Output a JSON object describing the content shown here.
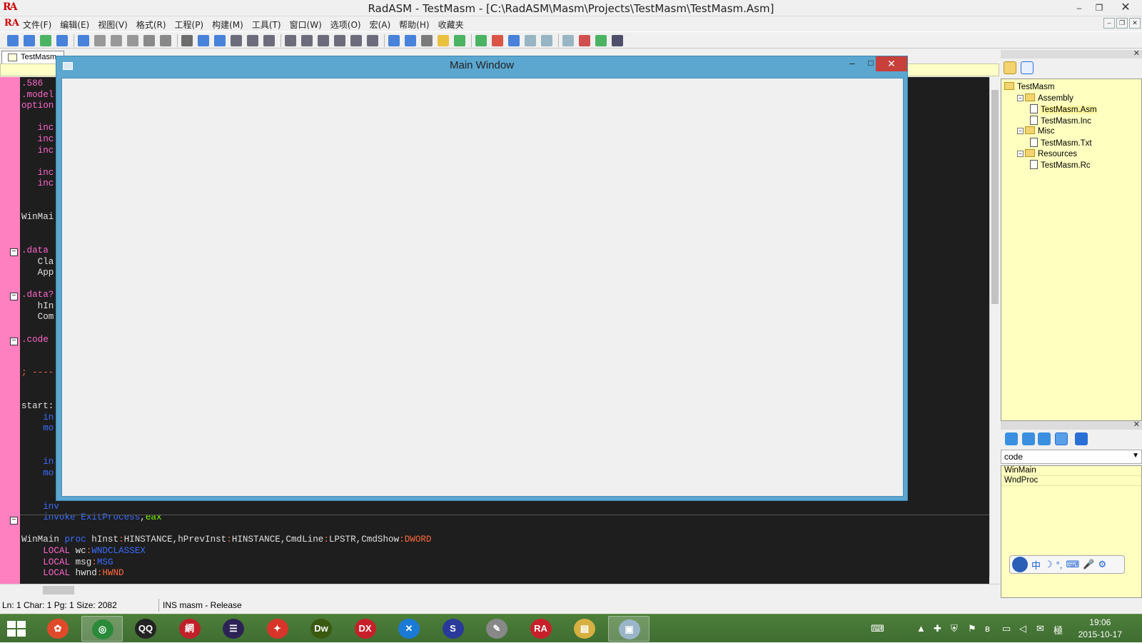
{
  "window": {
    "title": "RadASM - TestMasm - [C:\\RadASM\\Masm\\Projects\\TestMasm\\TestMasm.Asm]",
    "logo": "RA",
    "minimize_label": "–",
    "restore_label": "❐",
    "close_label": "✕"
  },
  "menu": {
    "items": [
      "文件(F)",
      "编辑(E)",
      "视图(V)",
      "格式(R)",
      "工程(P)",
      "构建(M)",
      "工具(T)",
      "窗口(W)",
      "选项(O)",
      "宏(A)",
      "帮助(H)",
      "收藏夹"
    ],
    "mdi_buttons": [
      "–",
      "❐",
      "✕"
    ]
  },
  "toolbar": {
    "icons": [
      "print-icon",
      "new-file-icon",
      "open-file-icon",
      "save-icon",
      "save-all-icon",
      "cut-icon",
      "copy-icon",
      "paste-icon",
      "undo-icon",
      "redo-icon",
      "delete-icon",
      "find-icon",
      "replace-icon",
      "bookmark-toggle-icon",
      "bookmark-next-icon",
      "bookmark-prev-icon",
      "bookmark-clear-icon",
      "indent-icon",
      "outdent-icon",
      "comment-icon",
      "uncomment-icon",
      "convert-case-icon",
      "dialog-edit-icon",
      "grid-icon",
      "build-tools-icon",
      "snap-icon",
      "compile-icon",
      "assemble-icon",
      "link-icon",
      "run-icon",
      "export-icon",
      "project-icon",
      "properties-icon",
      "color-palette-icon",
      "palette-icon",
      "preview-icon"
    ],
    "colors": {
      "blue": "#2a6fd6",
      "green": "#2fa84a",
      "red": "#d63a2a",
      "yellow": "#e8b820"
    }
  },
  "editor": {
    "tab_label": "TestMasm",
    "gutter_color": "#ff80c0",
    "background": "#1e1e1e",
    "visible_code": [
      [
        {
          "t": ".586",
          "c": "dir"
        }
      ],
      [
        {
          "t": ".model",
          "c": "dir"
        }
      ],
      [
        {
          "t": "option",
          "c": "dir"
        }
      ],
      [],
      [
        {
          "t": "   inc",
          "c": "dir"
        }
      ],
      [
        {
          "t": "   inc",
          "c": "dir"
        }
      ],
      [
        {
          "t": "   inc",
          "c": "dir"
        }
      ],
      [],
      [
        {
          "t": "   inc",
          "c": "dir"
        }
      ],
      [
        {
          "t": "   inc",
          "c": "dir"
        }
      ],
      [],
      [],
      [
        {
          "t": "WinMai",
          "c": "typ"
        }
      ],
      [],
      [],
      [
        {
          "t": ".data",
          "c": "dir"
        }
      ],
      [
        {
          "t": "   Cla",
          "c": "typ"
        }
      ],
      [
        {
          "t": "   App",
          "c": "typ"
        }
      ],
      [],
      [
        {
          "t": ".data?",
          "c": "dir"
        }
      ],
      [
        {
          "t": "   hIn",
          "c": "typ"
        }
      ],
      [
        {
          "t": "   Com",
          "c": "typ"
        }
      ],
      [],
      [
        {
          "t": ".code",
          "c": "dir"
        }
      ],
      [],
      [],
      [
        {
          "t": "; ----",
          "c": "red"
        }
      ],
      [],
      [],
      [
        {
          "t": "start:",
          "c": "typ"
        }
      ],
      [
        {
          "t": "    in",
          "c": "blu"
        }
      ],
      [
        {
          "t": "    mo",
          "c": "blu"
        }
      ],
      [],
      [],
      [
        {
          "t": "    in",
          "c": "blu"
        }
      ],
      [
        {
          "t": "    mo",
          "c": "blu"
        }
      ],
      [],
      [],
      [
        {
          "t": "    inv",
          "c": "blu"
        }
      ],
      [
        {
          "t": "    invoke ",
          "c": "blu"
        },
        {
          "t": "ExitProcess",
          "c": "blu"
        },
        {
          "t": ",",
          "c": "typ"
        },
        {
          "t": "eax",
          "c": "grn"
        }
      ],
      [],
      [
        {
          "t": "WinMain ",
          "c": "typ"
        },
        {
          "t": "proc",
          "c": "blu"
        },
        {
          "t": " hInst",
          "c": "typ"
        },
        {
          "t": ":",
          "c": "red"
        },
        {
          "t": "HINSTANCE",
          "c": "typ"
        },
        {
          "t": ",",
          "c": "typ"
        },
        {
          "t": "hPrevInst",
          "c": "typ"
        },
        {
          "t": ":",
          "c": "red"
        },
        {
          "t": "HINSTANCE",
          "c": "typ"
        },
        {
          "t": ",",
          "c": "typ"
        },
        {
          "t": "CmdLine",
          "c": "typ"
        },
        {
          "t": ":",
          "c": "red"
        },
        {
          "t": "LPSTR",
          "c": "typ"
        },
        {
          "t": ",",
          "c": "typ"
        },
        {
          "t": "CmdShow",
          "c": "typ"
        },
        {
          "t": ":",
          "c": "red"
        },
        {
          "t": "DWORD",
          "c": "red"
        }
      ],
      [
        {
          "t": "    LOCAL ",
          "c": "kw"
        },
        {
          "t": "wc",
          "c": "typ"
        },
        {
          "t": ":",
          "c": "red"
        },
        {
          "t": "WNDCLASSEX",
          "c": "blu"
        }
      ],
      [
        {
          "t": "    LOCAL ",
          "c": "kw"
        },
        {
          "t": "msg",
          "c": "typ"
        },
        {
          "t": ":",
          "c": "red"
        },
        {
          "t": "MSG",
          "c": "blu"
        }
      ],
      [
        {
          "t": "    LOCAL ",
          "c": "kw"
        },
        {
          "t": "hwnd",
          "c": "typ"
        },
        {
          "t": ":",
          "c": "red"
        },
        {
          "t": "HWND",
          "c": "red"
        }
      ]
    ]
  },
  "status": {
    "position": "Ln: 1 Char: 1 Pg: 1 Size: 2082",
    "mode": "INS masm - Release"
  },
  "project": {
    "tree": [
      {
        "label": "TestMasm",
        "kind": "folder",
        "level": 0
      },
      {
        "label": "Assembly",
        "kind": "folder",
        "level": 1
      },
      {
        "label": "TestMasm.Asm",
        "kind": "file",
        "level": 2,
        "selected": true
      },
      {
        "label": "TestMasm.Inc",
        "kind": "file",
        "level": 2
      },
      {
        "label": "Misc",
        "kind": "folder",
        "level": 1
      },
      {
        "label": "TestMasm.Txt",
        "kind": "file",
        "level": 2
      },
      {
        "label": "Resources",
        "kind": "folder",
        "level": 1
      },
      {
        "label": "TestMasm.Rc",
        "kind": "file",
        "level": 2
      }
    ],
    "panel_bg": "#ffffc0"
  },
  "properties": {
    "dropdown_value": "code",
    "procs": [
      "WinMain",
      "WndProc"
    ]
  },
  "ime": {
    "glyphs": [
      "中",
      "☽",
      "°,",
      "⌨",
      "🎤",
      "⚙"
    ]
  },
  "dialog": {
    "title": "Main Window",
    "frame_color": "#5ba7d0",
    "close_color": "#c7403a",
    "minimize_label": "–",
    "maximize_label": "□",
    "close_label": "✕"
  },
  "taskbar": {
    "apps": [
      {
        "name": "pinwheel-app-icon",
        "glyph": "✿",
        "color": "#e04a2a"
      },
      {
        "name": "chrome-icon",
        "glyph": "◎",
        "color": "#2a8a3a",
        "active": true
      },
      {
        "name": "qq-icon",
        "glyph": "QQ",
        "color": "#222"
      },
      {
        "name": "netease-icon",
        "glyph": "網",
        "color": "#c0202a"
      },
      {
        "name": "eclipse-icon",
        "glyph": "☰",
        "color": "#2c2255"
      },
      {
        "name": "xcode-bird-icon",
        "glyph": "✦",
        "color": "#d8352a"
      },
      {
        "name": "dreamweaver-icon",
        "glyph": "Dw",
        "color": "#3a5a10"
      },
      {
        "name": "dx-icon",
        "glyph": "DX",
        "color": "#c8202a"
      },
      {
        "name": "vs-icon",
        "glyph": "✕",
        "color": "#1a7ad6"
      },
      {
        "name": "s-app-icon",
        "glyph": "S",
        "color": "#2a3a9a"
      },
      {
        "name": "paint-icon",
        "glyph": "✎",
        "color": "#888"
      },
      {
        "name": "radasm-icon",
        "glyph": "RA",
        "color": "#c8202a"
      },
      {
        "name": "file-explorer-icon",
        "glyph": "▤",
        "color": "#d6b040"
      },
      {
        "name": "window-app-icon",
        "glyph": "▣",
        "color": "#9ab4c8",
        "active": true
      }
    ],
    "clock_time": "19:06",
    "clock_date": "2015-10-17",
    "tray": [
      "keyboard-icon",
      "chevron-up-icon",
      "plus-icon",
      "shield-icon",
      "flag-icon",
      "bluetooth-icon",
      "network-icon",
      "volume-icon",
      "wechat-icon",
      "input-method-icon"
    ]
  }
}
